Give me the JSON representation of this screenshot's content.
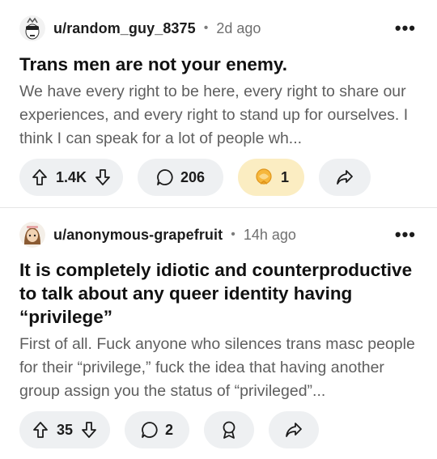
{
  "posts": [
    {
      "username": "u/random_guy_8375",
      "time": "2d ago",
      "title": "Trans men are not your enemy.",
      "body": "We have every right to be here, every right to share our experiences, and every right to stand up for ourselves. I think I can speak for a lot of people wh...",
      "votes": "1.4K",
      "comments": "206",
      "awards": "1"
    },
    {
      "username": "u/anonymous-grapefruit",
      "time": "14h ago",
      "title": "It is completely idiotic and counterproductive to talk about any queer identity having “privilege”",
      "body": "First of all. Fuck anyone who silences trans masc people for their “privilege,” fuck the idea that having another group assign you the status of “privileged”...",
      "votes": "35",
      "comments": "2"
    }
  ],
  "ui": {
    "separator": "•",
    "more_label": "•••"
  },
  "colors": {
    "pill_bg": "#eef0f2",
    "award_bg": "#fbedc2",
    "award_icon": "#f0a81e"
  }
}
